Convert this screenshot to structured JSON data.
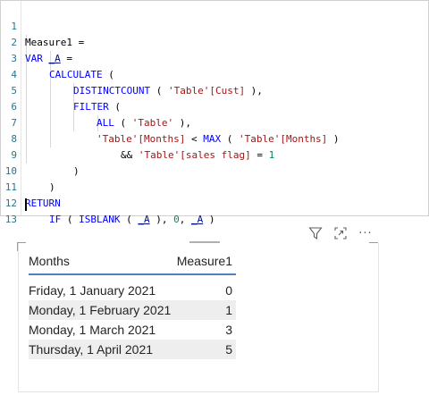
{
  "editor": {
    "line_numbers": [
      "1",
      "2",
      "3",
      "4",
      "5",
      "6",
      "7",
      "8",
      "9",
      "10",
      "11",
      "12",
      "13"
    ],
    "lines": {
      "l1": {
        "a": "Measure1 ="
      },
      "l2": {
        "kw": "VAR",
        "var": "_A",
        "rest": " ="
      },
      "l3": {
        "kw": "CALCULATE",
        "rest": " ("
      },
      "l4": {
        "kw": "DISTINCTCOUNT",
        "p1": " ( ",
        "str": "'Table'[Cust]",
        "p2": " ),"
      },
      "l5": {
        "kw": "FILTER",
        "rest": " ("
      },
      "l6": {
        "kw": "ALL",
        "p1": " ( ",
        "str": "'Table'",
        "p2": " ),"
      },
      "l7": {
        "str1": "'Table'[Months]",
        "op": " < ",
        "kw": "MAX",
        "p1": " ( ",
        "str2": "'Table'[Months]",
        "p2": " )"
      },
      "l8": {
        "op": "&& ",
        "str": "'Table'[sales flag]",
        "eq": " = ",
        "num": "1"
      },
      "l9": {
        "a": ")"
      },
      "l10": {
        "a": ")"
      },
      "l11": {
        "kw": "RETURN"
      },
      "l12": {
        "kw1": "IF",
        "p1": " ( ",
        "kw2": "ISBLANK",
        "p2": " ( ",
        "var1": "_A",
        "p3": " ), ",
        "num": "0",
        "p4": ", ",
        "var2": "_A",
        "p5": " )"
      },
      "l13": {
        "a": ""
      }
    }
  },
  "visual_header": {
    "icons": [
      "filter-icon",
      "focus-mode-icon",
      "more-options-icon"
    ],
    "more_label": "···"
  },
  "table": {
    "columns": [
      "Months",
      "Measure1"
    ],
    "rows": [
      {
        "month": "Friday, 1 January 2021",
        "value": "0"
      },
      {
        "month": "Monday, 1 February 2021",
        "value": "1"
      },
      {
        "month": "Monday, 1 March 2021",
        "value": "3"
      },
      {
        "month": "Thursday, 1 April 2021",
        "value": "5"
      }
    ],
    "header_underline_color": "#4f81bd",
    "alt_row_color": "#eeeeee"
  }
}
